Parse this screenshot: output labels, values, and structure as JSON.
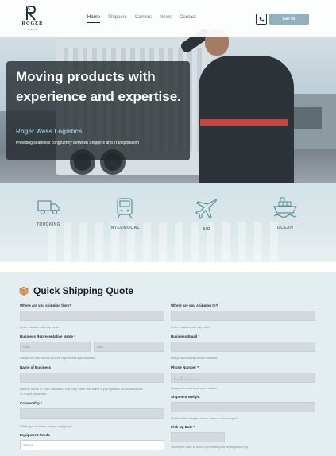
{
  "header": {
    "logo_text": "ROGER",
    "logo_sub": "WESS",
    "nav": [
      "Home",
      "Shippers",
      "Carriers",
      "News",
      "Contact"
    ],
    "call_label": "Call Us",
    "phone_icon": "phone-icon"
  },
  "hero": {
    "title": "Moving products with experience and expertise.",
    "subtitle": "Roger Wess Logistics",
    "description": "Providing seamless congruency between Shippers and Transportation"
  },
  "services": [
    {
      "label": "TRUCKING",
      "icon": "truck-icon"
    },
    {
      "label": "INTERMODAL",
      "icon": "train-icon"
    },
    {
      "label": "AIR",
      "icon": "airplane-icon"
    },
    {
      "label": "OCEAN",
      "icon": "ship-icon"
    }
  ],
  "quote": {
    "title": "Quick Shipping Quote",
    "icon": "package-icon",
    "left": {
      "from_label": "Where are you shipping from?",
      "from_hint": "Enter location with zip code",
      "rep_label": "Business Representative Name *",
      "first_placeholder": "First",
      "last_placeholder": "Last",
      "rep_hint": "Please list the individual who represents this business.",
      "business_label": "Name of Business",
      "business_hint_1": "List the name of your business. You may leave this blank if you operate as an individual",
      "business_hint_2": "or a sole proprietor.",
      "commodity_label": "Commodity *",
      "commodity_hint": "What type of items are you shipping?",
      "equipment_label": "Equipment Needs",
      "equipment_value": "Select"
    },
    "right": {
      "to_label": "Where are you shipping to?",
      "to_hint": "Enter location with zip code",
      "email_label": "Business Email *",
      "email_hint": "List your business email address.",
      "phone_label": "Phone Number *",
      "phone_placeholder": "(___) ___-____",
      "phone_hint": "List your business phone number.",
      "weight_label": "Shipment Weight",
      "weight_hint": "List the total weight of your items to be shipped.",
      "pickup_label": "Pick Up Date *",
      "pickup_hint": "Select the date in which you want your items picked up."
    }
  }
}
